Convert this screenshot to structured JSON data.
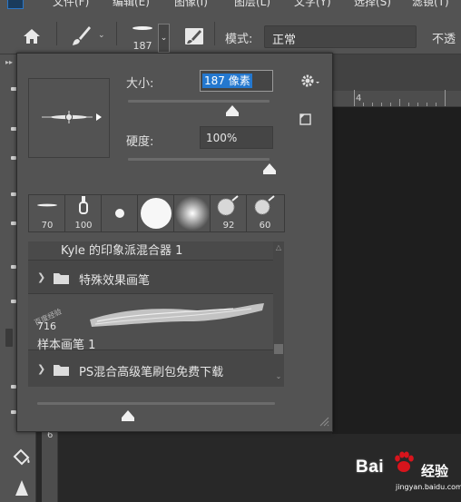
{
  "menubar": {
    "items": [
      "文件(F)",
      "编辑(E)",
      "图像(I)",
      "图层(L)",
      "文字(Y)",
      "选择(S)",
      "滤镜(T)"
    ]
  },
  "options_bar": {
    "brush_size": "187",
    "mode_label": "模式:",
    "mode_value": "正常",
    "opacity_label": "不透"
  },
  "brush_picker": {
    "size_label": "大小:",
    "size_value": "187 像素",
    "size_fraction": 0.74,
    "hardness_label": "硬度:",
    "hardness_value": "100%",
    "hardness_fraction": 1.0,
    "recent_brushes": [
      {
        "label": "70",
        "icon": "flat-stroke-icon"
      },
      {
        "label": "100",
        "icon": "chisel-brush-icon"
      },
      {
        "label": "",
        "icon": "small-round-icon"
      },
      {
        "label": "",
        "icon": "hard-round-icon"
      },
      {
        "label": "",
        "icon": "soft-round-icon"
      },
      {
        "label": "92",
        "icon": "textured-brush-icon"
      },
      {
        "label": "60",
        "icon": "textured-brush-icon"
      }
    ],
    "preset_list": {
      "group_header": "Kyle 的印象派混合器 1",
      "folder_special": "特殊效果画笔",
      "sample_brush_size": "716",
      "sample_brush_name": "样本画笔 1",
      "sample_watermark": "百度经验",
      "folder_download": "PS混合高级笔刷包免费下载"
    },
    "bottom_slider_fraction": 0.38
  },
  "ruler": {
    "h_number": "4",
    "v_number": "6"
  },
  "watermark": {
    "brand": "Bai",
    "brand_suffix": "经验",
    "url": "jingyan.baidu.com"
  }
}
